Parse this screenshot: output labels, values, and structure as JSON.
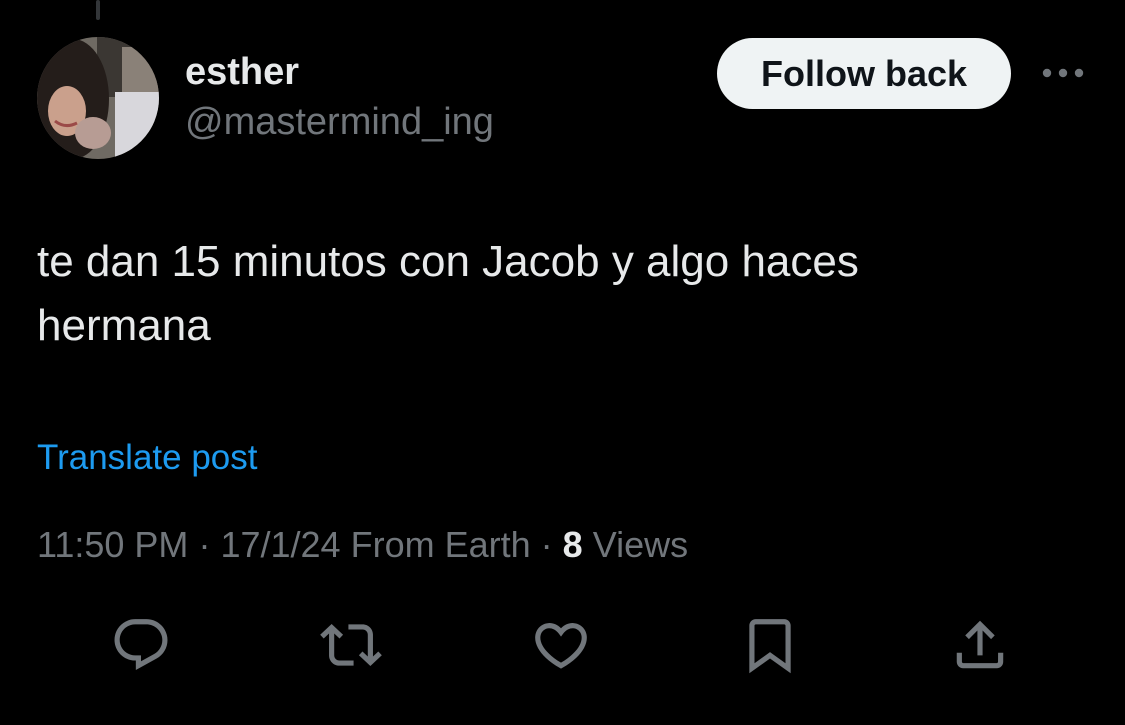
{
  "author": {
    "display_name": "esther",
    "handle": "@mastermind_ing",
    "follow_button_label": "Follow back",
    "more_icon": "more-horizontal-icon",
    "avatar_icon": "avatar-photo"
  },
  "post": {
    "text_lines": [
      "te dan 15 minutos con Jacob y algo haces",
      "hermana"
    ],
    "translate_label": "Translate post"
  },
  "meta": {
    "time": "11:50 PM",
    "date": "17/1/24",
    "source": "From Earth",
    "views_count": "8",
    "views_label": "Views"
  },
  "actions": [
    {
      "name": "reply",
      "icon": "reply-icon"
    },
    {
      "name": "repost",
      "icon": "repost-icon"
    },
    {
      "name": "like",
      "icon": "heart-icon"
    },
    {
      "name": "bookmark",
      "icon": "bookmark-icon"
    },
    {
      "name": "share",
      "icon": "share-icon"
    }
  ],
  "colors": {
    "background": "#000000",
    "primary_text": "#e7e9ea",
    "secondary_text": "#71767b",
    "link": "#1d9bf0",
    "follow_button_bg": "#eff3f4",
    "follow_button_text": "#0f1419"
  }
}
